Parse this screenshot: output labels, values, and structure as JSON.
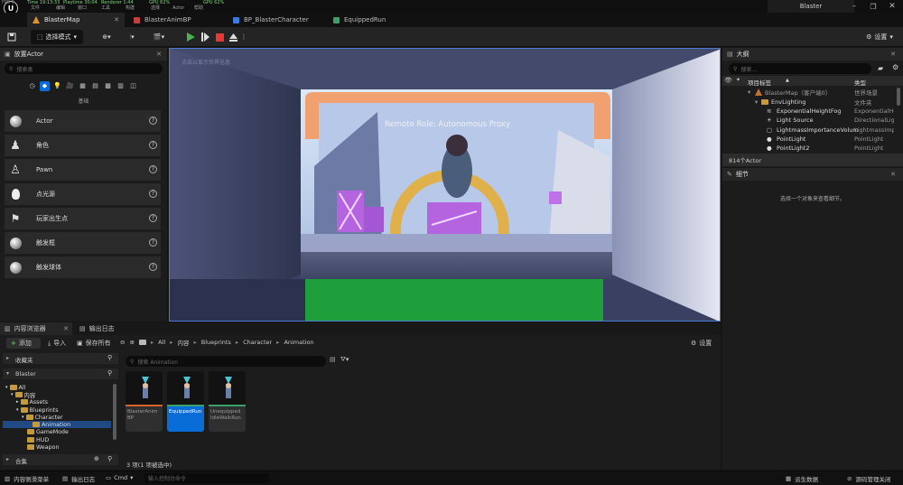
{
  "titlebar": {
    "app_title": "Blaster",
    "stats": [
      "FPS 0",
      "Time 19:13:33",
      "Playtime 30:04",
      "Renderer 1:44",
      "GPU 62%",
      "GPU 62%"
    ],
    "menus": [
      "文件",
      "编辑",
      "窗口",
      "工具",
      "构建",
      "选择",
      "Actor",
      "帮助"
    ]
  },
  "tabs": [
    {
      "label": "BlasterMap",
      "active": true
    },
    {
      "label": "BlasterAnimBP",
      "active": false
    },
    {
      "label": "BP_BlasterCharacter",
      "active": false
    },
    {
      "label": "EquippedRun",
      "active": false
    }
  ],
  "toolbar": {
    "select_mode": "选择模式",
    "settings": "设置"
  },
  "place_actors": {
    "title": "放置Actor",
    "search_placeholder": "搜索类",
    "category": "基础",
    "items": [
      "Actor",
      "角色",
      "Pawn",
      "点光源",
      "玩家出生点",
      "触发框",
      "触发球体"
    ]
  },
  "viewport": {
    "overlay_text": "Remote Role: Autonomous Proxy",
    "hint": "点击以显示世界信息"
  },
  "outliner": {
    "title": "大纲",
    "search_placeholder": "搜索...",
    "col_label": "项目标签",
    "col_type": "类型",
    "rows": [
      {
        "name": "BlasterMap（客户端0）",
        "type": "世界场景"
      },
      {
        "name": "EnvLighting",
        "type": "文件夹"
      },
      {
        "name": "ExponentialHeightFog",
        "type": "ExponentialHe"
      },
      {
        "name": "Light Source",
        "type": "DirectionalLig"
      },
      {
        "name": "LightmassImportanceVolum",
        "type": "LightmassImp"
      },
      {
        "name": "PointLight",
        "type": "PointLight"
      },
      {
        "name": "PointLight2",
        "type": "PointLight"
      }
    ],
    "count": "814个Actor"
  },
  "details": {
    "title": "细节",
    "empty_text": "选择一个对象来查看细节。"
  },
  "content_browser": {
    "title": "内容浏览器",
    "output_tab": "输出日志",
    "add": "添加",
    "import": "导入",
    "save_all": "保存所有",
    "path": [
      "All",
      "内容",
      "Blueprints",
      "Character",
      "Animation"
    ],
    "settings": "设置",
    "favorites": "收藏夹",
    "project": "Blaster",
    "collections": "合集",
    "search_placeholder": "搜索 Animation",
    "tree": [
      "All",
      "内容",
      "Assets",
      "Blueprints",
      "Character",
      "Animation",
      "GameMode",
      "HUD",
      "Weapon"
    ],
    "assets": [
      {
        "name": "BlasterAnim BP",
        "selected": false
      },
      {
        "name": "EquippedRun",
        "selected": true
      },
      {
        "name": "Unequipped IdleWalkRun",
        "selected": false
      }
    ],
    "status": "3 项(1 项被选中)"
  },
  "statusbar": {
    "drawer": "内容侧滑菜单",
    "output_log": "输出日志",
    "cmd": "Cmd",
    "cmd_placeholder": "输入控制台命令",
    "derived_data": "派生数据",
    "source_control": "源码管理关闭"
  },
  "colors": {
    "accent_blue": "#0a6cd6",
    "play_green": "#4caf50",
    "stop_red": "#e53935",
    "panel_bg": "#1c1c1c"
  }
}
